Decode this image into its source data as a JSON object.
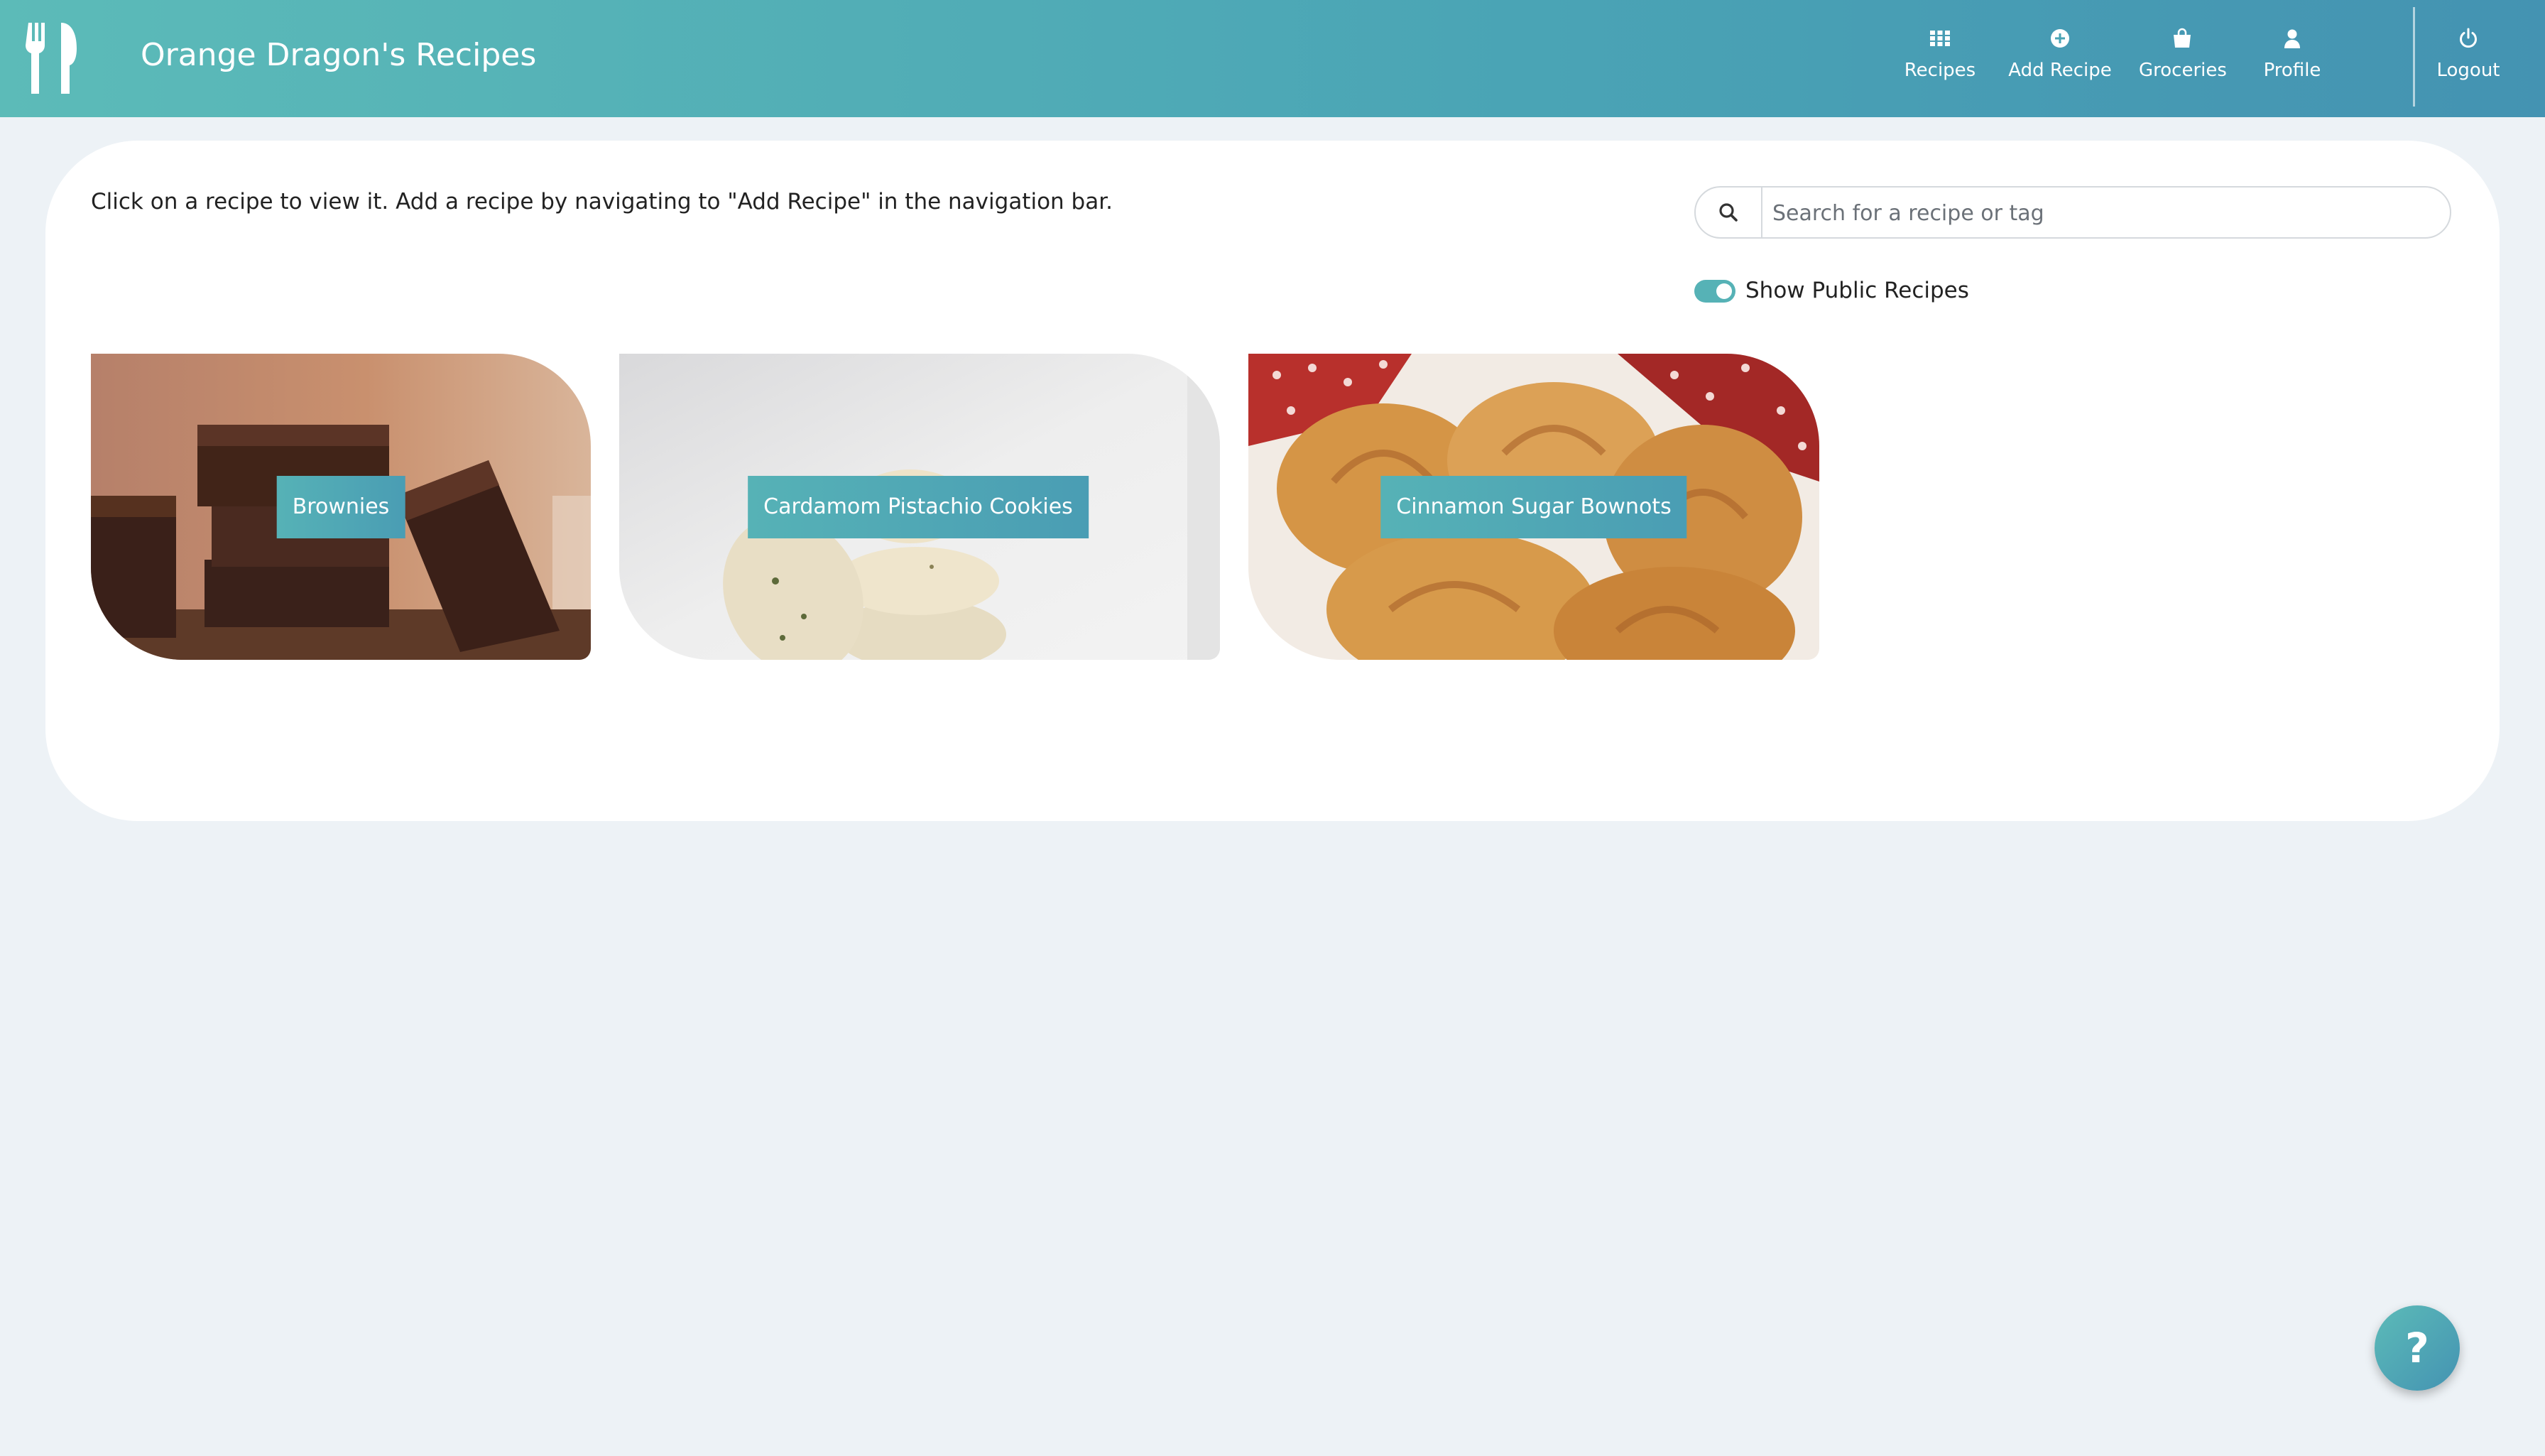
{
  "app": {
    "title": "Orange Dragon's Recipes",
    "logo_icon": "fork-knife-icon"
  },
  "nav": {
    "items": [
      {
        "label": "Recipes",
        "icon": "grid-icon"
      },
      {
        "label": "Add Recipe",
        "icon": "plus-circle-icon"
      },
      {
        "label": "Groceries",
        "icon": "shopping-bag-icon"
      },
      {
        "label": "Profile",
        "icon": "user-icon"
      },
      {
        "label": "Logout",
        "icon": "power-icon"
      }
    ]
  },
  "main": {
    "intro": "Click on a recipe to view it. Add a recipe by navigating to \"Add Recipe\" in the navigation bar.",
    "search": {
      "placeholder": "Search for a recipe or tag",
      "value": ""
    },
    "toggle": {
      "label": "Show Public Recipes",
      "on": true
    },
    "recipes": [
      {
        "name": "Brownies"
      },
      {
        "name": "Cardamom Pistachio Cookies"
      },
      {
        "name": "Cinnamon Sugar Bownots"
      }
    ]
  },
  "help": {
    "label": "?"
  },
  "colors": {
    "accent": "#56b2b6",
    "accent_dark": "#4493b2",
    "background": "#edf2f6"
  }
}
